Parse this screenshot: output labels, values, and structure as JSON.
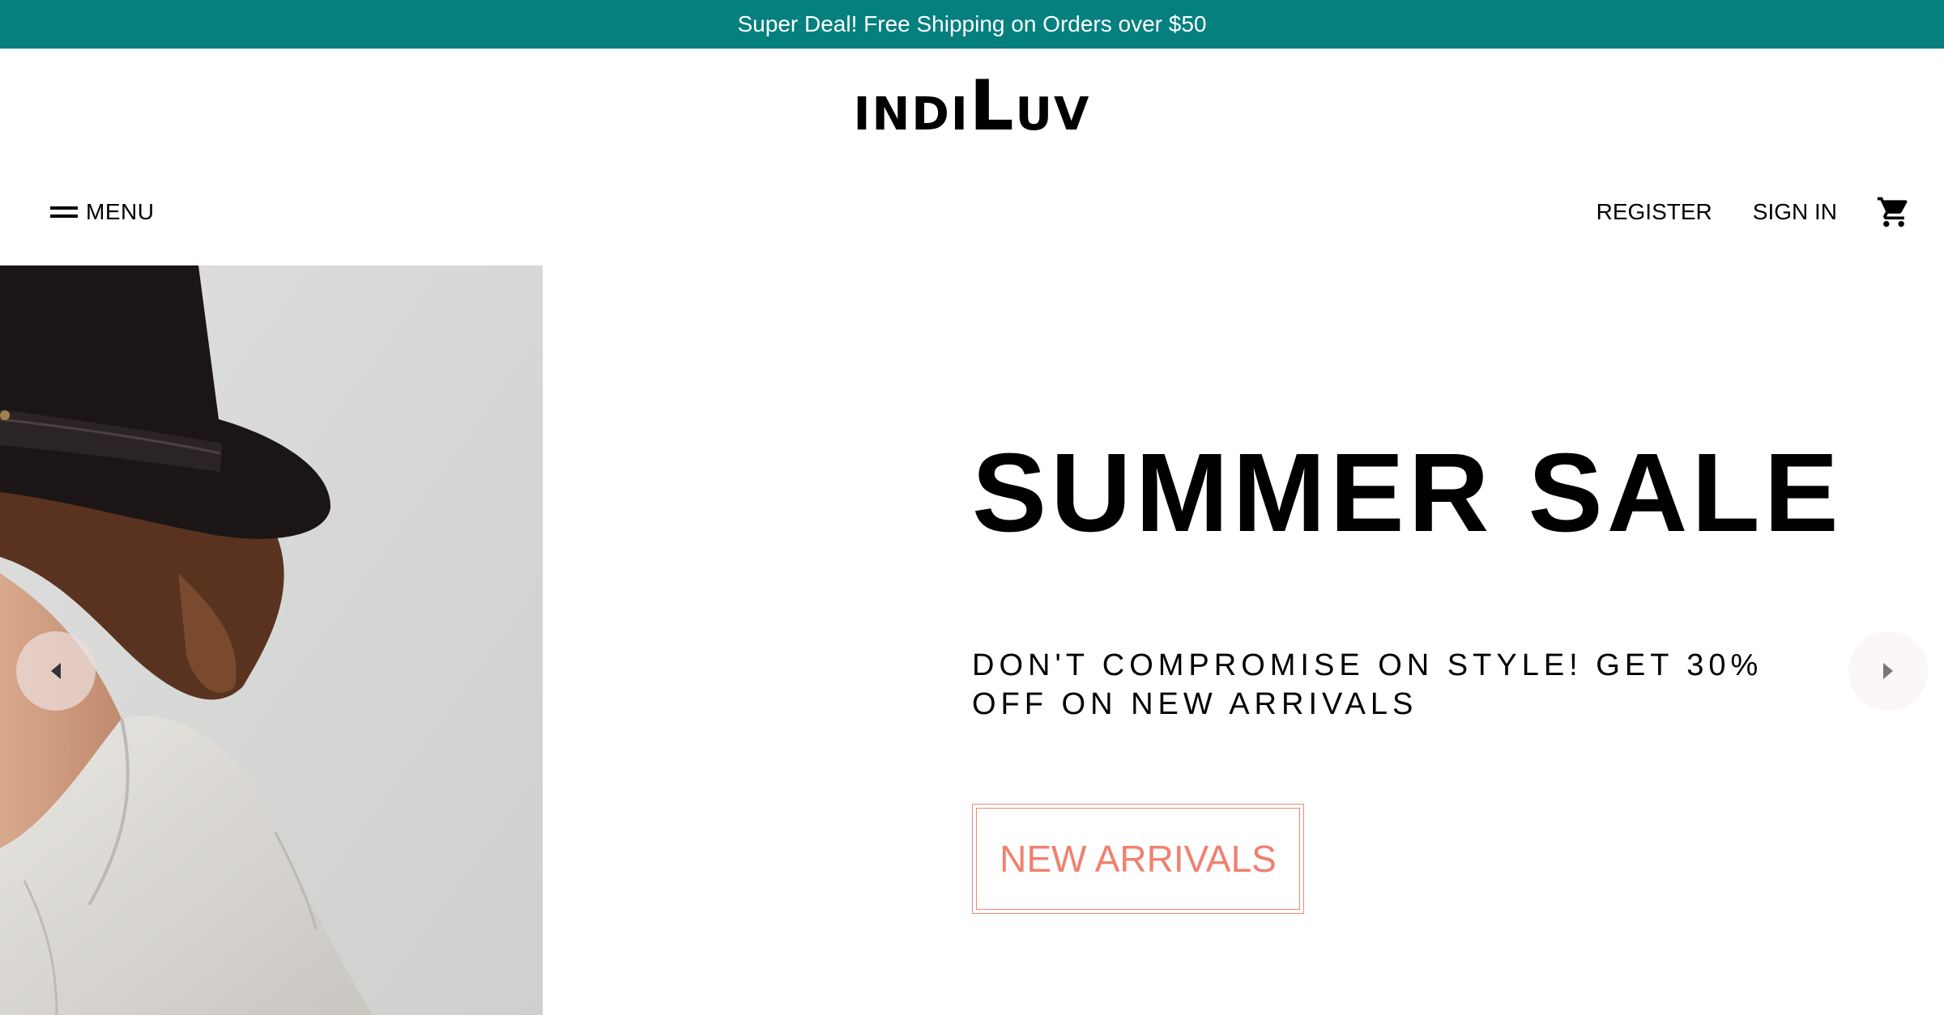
{
  "promo": {
    "text": "Super Deal! Free Shipping on Orders over $50"
  },
  "brand": {
    "part1": "INDI",
    "part2": "L",
    "part3": "UV"
  },
  "nav": {
    "menu_label": "MENU",
    "register_label": "REGISTER",
    "signin_label": "SIGN IN"
  },
  "hero": {
    "headline": "SUMMER SALE",
    "subtext": "DON'T COMPROMISE ON STYLE! GET 30% OFF ON NEW ARRIVALS",
    "cta_label": "NEW ARRIVALS"
  },
  "icons": {
    "menu": "hamburger-icon",
    "cart": "cart-icon",
    "prev": "chevron-left-icon",
    "next": "chevron-right-icon"
  },
  "colors": {
    "promo_bg": "#067f7f",
    "cta_accent": "#f0806f"
  }
}
